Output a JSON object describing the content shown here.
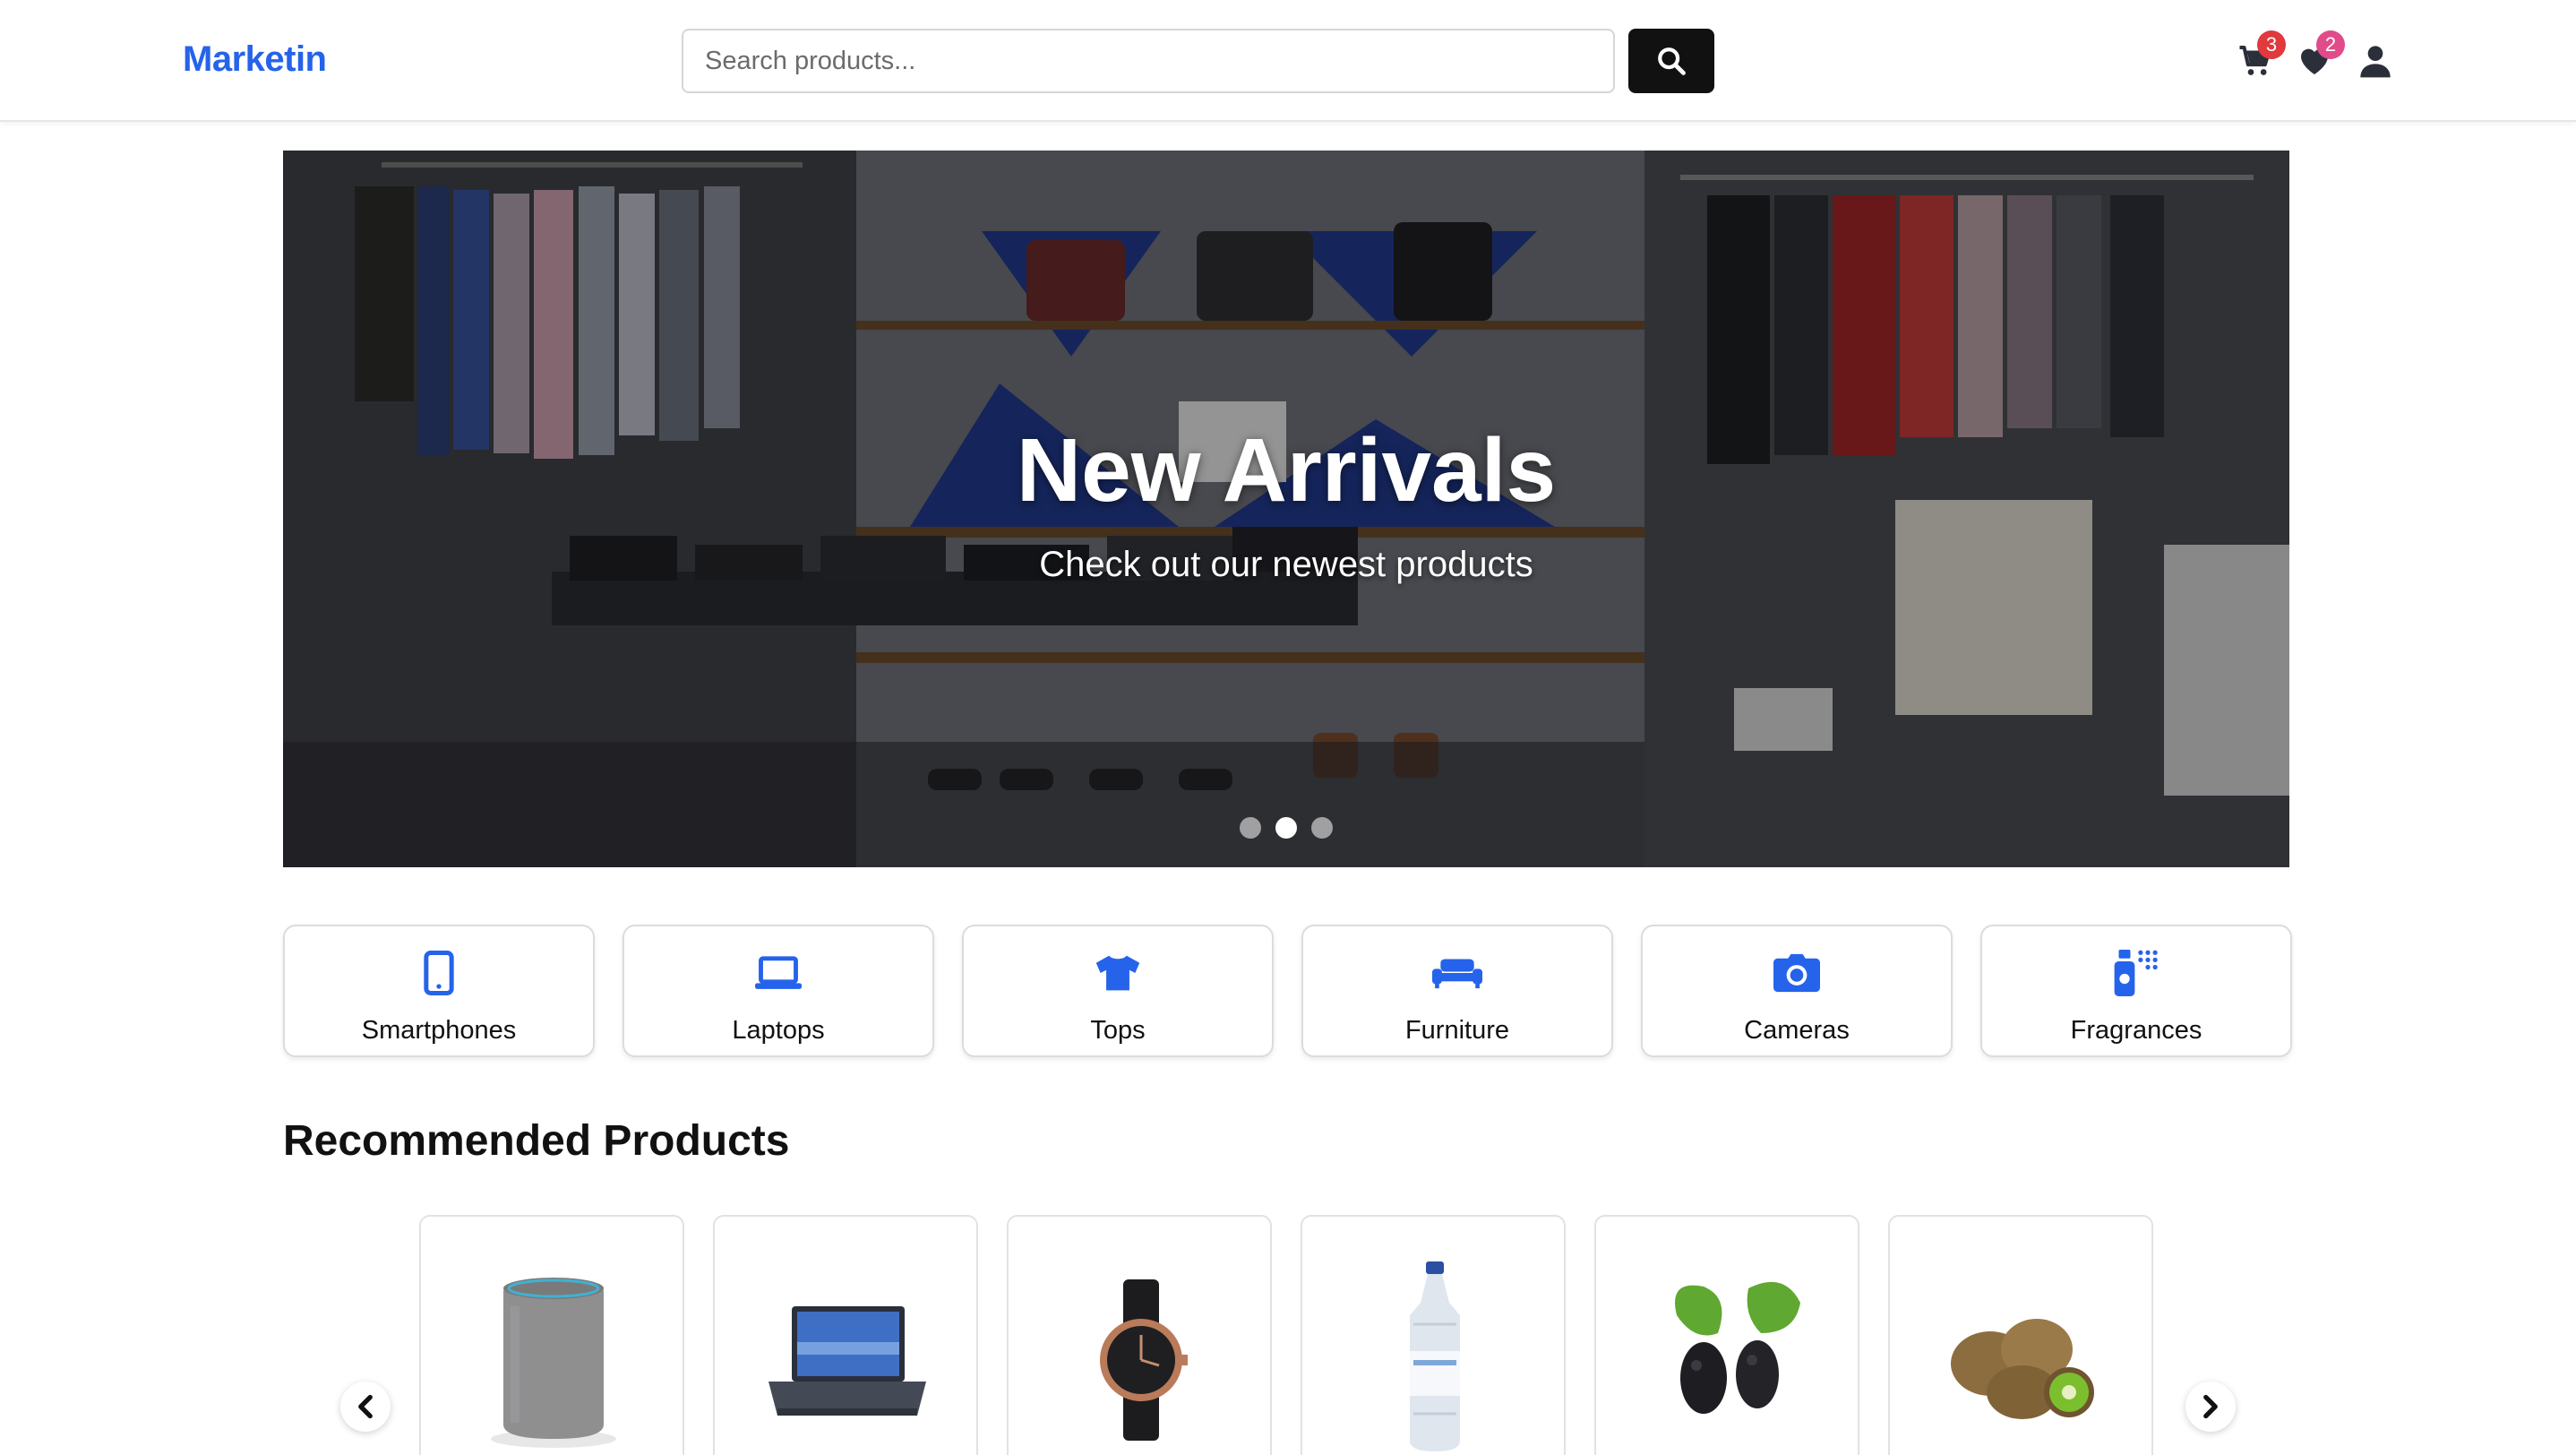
{
  "header": {
    "logo": "Marketin",
    "search_placeholder": "Search products...",
    "cart_count": "3",
    "wishlist_count": "2",
    "icons": [
      "search-icon",
      "cart-icon",
      "heart-icon",
      "user-icon"
    ]
  },
  "hero": {
    "title": "New Arrivals",
    "subtitle": "Check out our newest products",
    "slide_count": 3,
    "active_slide": 2
  },
  "categories": [
    {
      "label": "Smartphones",
      "icon": "smartphone-icon"
    },
    {
      "label": "Laptops",
      "icon": "laptop-icon"
    },
    {
      "label": "Tops",
      "icon": "tshirt-icon"
    },
    {
      "label": "Furniture",
      "icon": "couch-icon"
    },
    {
      "label": "Cameras",
      "icon": "camera-icon"
    },
    {
      "label": "Fragrances",
      "icon": "spray-bottle-icon"
    }
  ],
  "recommended": {
    "title": "Recommended Products",
    "products": [
      {
        "image": "smart-speaker-image"
      },
      {
        "image": "laptop-image"
      },
      {
        "image": "wristwatch-image"
      },
      {
        "image": "water-bottle-image"
      },
      {
        "image": "mulberry-image"
      },
      {
        "image": "kiwi-image"
      }
    ]
  },
  "colors": {
    "brand": "#2563eb",
    "cart_badge": "#e0393e",
    "wishlist_badge": "#e14b8a",
    "search_button": "#111111"
  }
}
